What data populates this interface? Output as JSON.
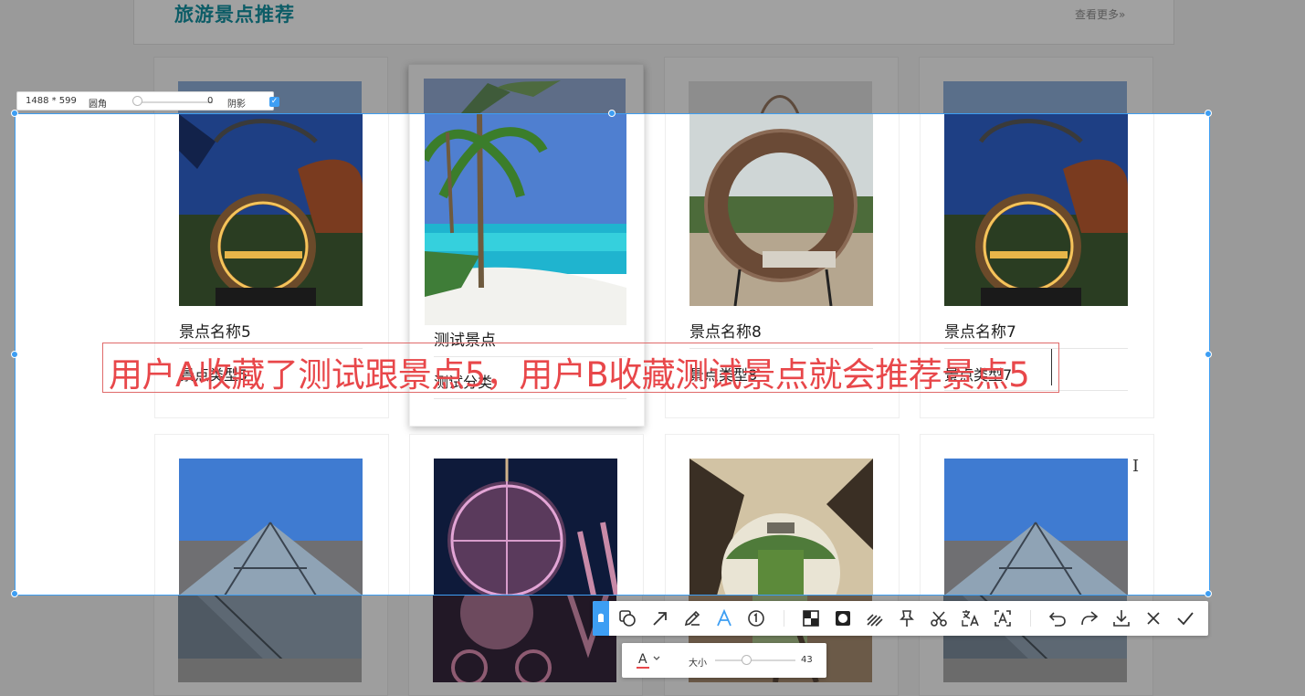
{
  "page": {
    "section_title": "旅游景点推荐",
    "view_more": "查看更多»"
  },
  "cards_row1": [
    {
      "name": "景点名称5",
      "type": "景点类型5"
    },
    {
      "name": "测试景点",
      "type": "测试分类"
    },
    {
      "name": "景点名称8",
      "type": "景点类型8"
    },
    {
      "name": "景点名称7",
      "type": "景点类型7"
    }
  ],
  "selection_info": {
    "dimensions": "1488 * 599",
    "radius_label": "圆角",
    "radius_value": "0",
    "shadow_label": "阴影",
    "shadow_checked": true
  },
  "annotation": {
    "text": "用户A收藏了测试跟景点5，用户B收藏测试景点就会推荐景点5",
    "color": "#e8474a"
  },
  "toolbar": {
    "tools": [
      "shape-icon",
      "arrow-icon",
      "pen-icon",
      "text-icon",
      "number-icon",
      "mosaic-icon",
      "blur-icon",
      "highlight-icon",
      "pin-icon",
      "scissors-icon",
      "translate-icon",
      "ocr-icon",
      "undo-icon",
      "redo-icon",
      "download-icon",
      "close-icon",
      "confirm-icon"
    ],
    "active_tool": "text-icon",
    "accent": "#3d9ef3"
  },
  "font_size_popover": {
    "font_color_label": "A",
    "size_label": "大小",
    "size_value": "43"
  }
}
